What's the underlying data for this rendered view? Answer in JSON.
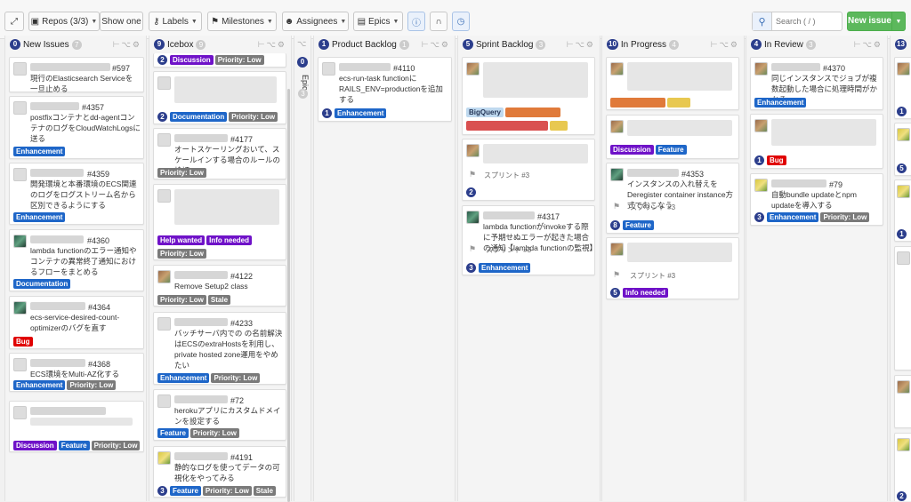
{
  "toolbar": {
    "collapse_icon": "collapse-arrows-icon",
    "repos_label": "Repos (3/3)",
    "show_one_label": "Show one",
    "labels_label": "Labels",
    "milestones_label": "Milestones",
    "assignees_label": "Assignees",
    "epics_label": "Epics",
    "search_placeholder": "Search ( / )",
    "new_issue_label": "New issue"
  },
  "columns": {
    "new_issues": {
      "num": "0",
      "title": "New Issues",
      "count": "7"
    },
    "icebox": {
      "num": "9",
      "title": "Icebox",
      "count": "9"
    },
    "epic": {
      "num": "0",
      "title": "Epic",
      "count": "3"
    },
    "product_backlog": {
      "num": "1",
      "title": "Product Backlog",
      "count": "1"
    },
    "sprint_backlog": {
      "num": "5",
      "title": "Sprint Backlog",
      "count": "3"
    },
    "in_progress": {
      "num": "10",
      "title": "In Progress",
      "count": "4"
    },
    "in_review": {
      "num": "4",
      "title": "In Review",
      "count": "3"
    },
    "next": {
      "num": "13"
    }
  },
  "labels": {
    "enhancement": "Enhancement",
    "documentation": "Documentation",
    "bug": "Bug",
    "discussion": "Discussion",
    "feature": "Feature",
    "priority_low": "Priority: Low",
    "stale": "Stale",
    "help_wanted": "Help wanted",
    "info_needed": "Info needed",
    "bigquery": "BigQuery"
  },
  "cards": {
    "c597": {
      "num": "#597",
      "body": "現行のElasticsearch Serviceを一旦止める"
    },
    "c4357": {
      "num": "#4357",
      "body": "postfixコンテナとdd-agentコンテナのログをCloudWatchLogsに送る"
    },
    "c4359": {
      "num": "#4359",
      "body": "開発環境と本番環境のECS関連のログをログストリーム名から区別できるようにする"
    },
    "c4360": {
      "num": "#4360",
      "body": "lambda functionのエラー通知やコンテナの異常終了通知におけるフローをまとめる"
    },
    "c4364": {
      "num": "#4364",
      "body": "ecs-service-desired-count-optimizerのバグを直す"
    },
    "c4368": {
      "num": "#4368",
      "body": "ECS環境をMulti-AZ化する"
    },
    "c4177": {
      "num": "#4177",
      "body": "オートスケーリングおいて、スケールインする場合のルールの検証"
    },
    "c4122": {
      "num": "#4122",
      "body": "Remove Setup2 class"
    },
    "c4233": {
      "num": "#4233",
      "body": "バッチサーバ内での の名前解決はECSのextraHostsを利用し、private hosted zone運用をやめたい"
    },
    "c72": {
      "num": "#72",
      "body": "herokuアプリにカスタムドメインを設定する"
    },
    "c4191": {
      "num": "#4191",
      "body": "静的なログを使ってデータの可視化をやってみる"
    },
    "c4110": {
      "num": "#4110",
      "body": "ecs-run-task functionにRAILS_ENV=productionを追加する"
    },
    "c4317": {
      "num": "#4317",
      "body": "lambda functionがinvokeする際に予期せぬエラーが起きた場合の通知【lambda functionの監視】"
    },
    "c4353": {
      "num": "#4353",
      "body": "インスタンスの入れ替えをDeregister container instance方式でおこなう"
    },
    "c4370": {
      "num": "#4370",
      "body": "同じインスタンスでジョブが複数起動した場合に処理時間がかかる"
    },
    "c79": {
      "num": "#79",
      "body": "自動bundle updateとnpm updateを導入する"
    }
  },
  "sprint": "スプリント #3",
  "badges": {
    "two": "2",
    "three": "3",
    "eight": "8",
    "five": "5",
    "one": "1"
  }
}
